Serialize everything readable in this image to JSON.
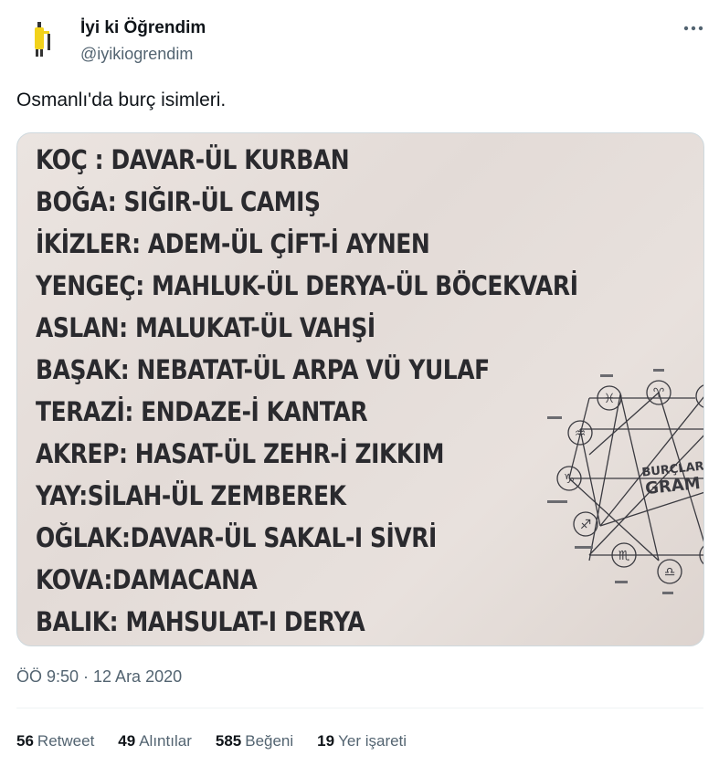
{
  "author": {
    "display_name": "İyi ki Öğrendim",
    "handle": "@iyikiogrendim",
    "avatar_icon": "yellow-figure-avatar",
    "more_icon": "more-dots-icon"
  },
  "tweet": {
    "text": "Osmanlı'da burç isimleri.",
    "timestamp": "ÖÖ 9:50 · 12 Ara 2020"
  },
  "media": {
    "lines": [
      "KOÇ : DAVAR-ÜL KURBAN",
      "BOĞA: SIĞIR-ÜL CAMIŞ",
      "İKİZLER: ADEM-ÜL ÇİFT-İ AYNEN",
      "YENGEÇ: MAHLUK-ÜL DERYA-ÜL BÖCEKVARİ",
      "ASLAN: MALUKAT-ÜL VAHŞİ",
      "BAŞAK: NEBATAT-ÜL ARPA VÜ YULAF",
      "TERAZİ: ENDAZE-İ KANTAR",
      "AKREP: HASAT-ÜL ZEHR-İ ZIKKIM",
      "YAY:SİLAH-ÜL ZEMBEREK",
      "OĞLAK:DAVAR-ÜL SAKAL-I SİVRİ",
      "KOVA:DAMACANA",
      "BALIK: MAHSULAT-I DERYA"
    ],
    "wheel_text_1": "BURÇLAR",
    "wheel_text_2": "GRAM",
    "accent_color": "#3a3a40",
    "background_color": "#e6dfdb"
  },
  "stats": [
    {
      "count": "56",
      "label": "Retweet"
    },
    {
      "count": "49",
      "label": "Alıntılar"
    },
    {
      "count": "585",
      "label": "Beğeni"
    },
    {
      "count": "19",
      "label": "Yer işareti"
    }
  ]
}
